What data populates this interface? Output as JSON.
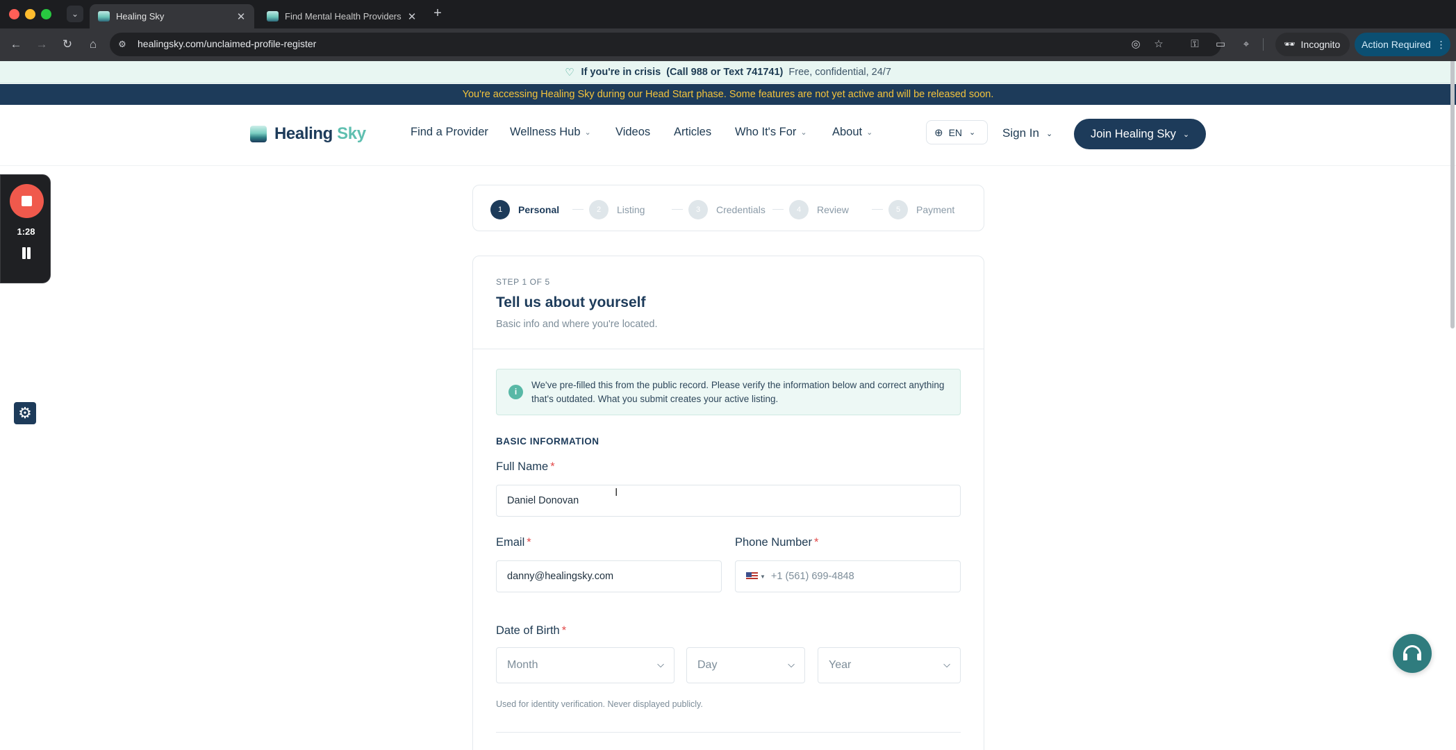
{
  "browser": {
    "tabs": [
      {
        "label": "Healing Sky",
        "active": true
      },
      {
        "label": "Find Mental Health Providers",
        "active": false
      }
    ],
    "url": "healingsky.com/unclaimed-profile-register",
    "incognito_label": "Incognito",
    "action_required_label": "Action Required"
  },
  "banners": {
    "crisis_bold": "If you're in crisis",
    "crisis_contact": "(Call 988 or Text 741741)",
    "crisis_rest": "Free, confidential, 24/7",
    "headstart": "You're accessing Healing Sky during our Head Start phase. Some features are not yet active and will be released soon."
  },
  "header": {
    "logo_part1": "Healing",
    "logo_part2": "Sky",
    "nav": [
      {
        "label": "Find a Provider",
        "dropdown": false
      },
      {
        "label": "Wellness Hub",
        "dropdown": true
      },
      {
        "label": "Videos",
        "dropdown": false
      },
      {
        "label": "Articles",
        "dropdown": false
      },
      {
        "label": "Who It's For",
        "dropdown": true
      },
      {
        "label": "About",
        "dropdown": true
      }
    ],
    "language": "EN",
    "sign_in": "Sign In",
    "join": "Join Healing Sky"
  },
  "recorder": {
    "time": "1:28"
  },
  "stepper": {
    "steps": [
      {
        "number": "1",
        "label": "Personal",
        "current": true
      },
      {
        "number": "2",
        "label": "Listing",
        "current": false
      },
      {
        "number": "3",
        "label": "Credentials",
        "current": false
      },
      {
        "number": "4",
        "label": "Review",
        "current": false
      },
      {
        "number": "5",
        "label": "Payment",
        "current": false
      }
    ]
  },
  "form": {
    "eyebrow": "STEP 1 OF 5",
    "title": "Tell us about yourself",
    "subtitle": "Basic info and where you're located.",
    "notice": "We've pre-filled this from the public record. Please verify the information below and correct anything that's outdated. What you submit creates your active listing.",
    "section": "BASIC INFORMATION",
    "full_name_label": "Full Name",
    "full_name_value": "Daniel Donovan",
    "email_label": "Email",
    "email_value": "danny@healingsky.com",
    "phone_label": "Phone Number",
    "phone_placeholder": "+1 (561) 699-4848",
    "dob_label": "Date of Birth",
    "month_placeholder": "Month",
    "day_placeholder": "Day",
    "year_placeholder": "Year",
    "dob_hint": "Used for identity verification. Never displayed publicly.",
    "required_mark": "*"
  },
  "colors": {
    "brand_navy": "#1d3b5a",
    "brand_teal": "#5fbfb0",
    "headstart_text": "#f3c33c",
    "required": "#e24b4b"
  }
}
